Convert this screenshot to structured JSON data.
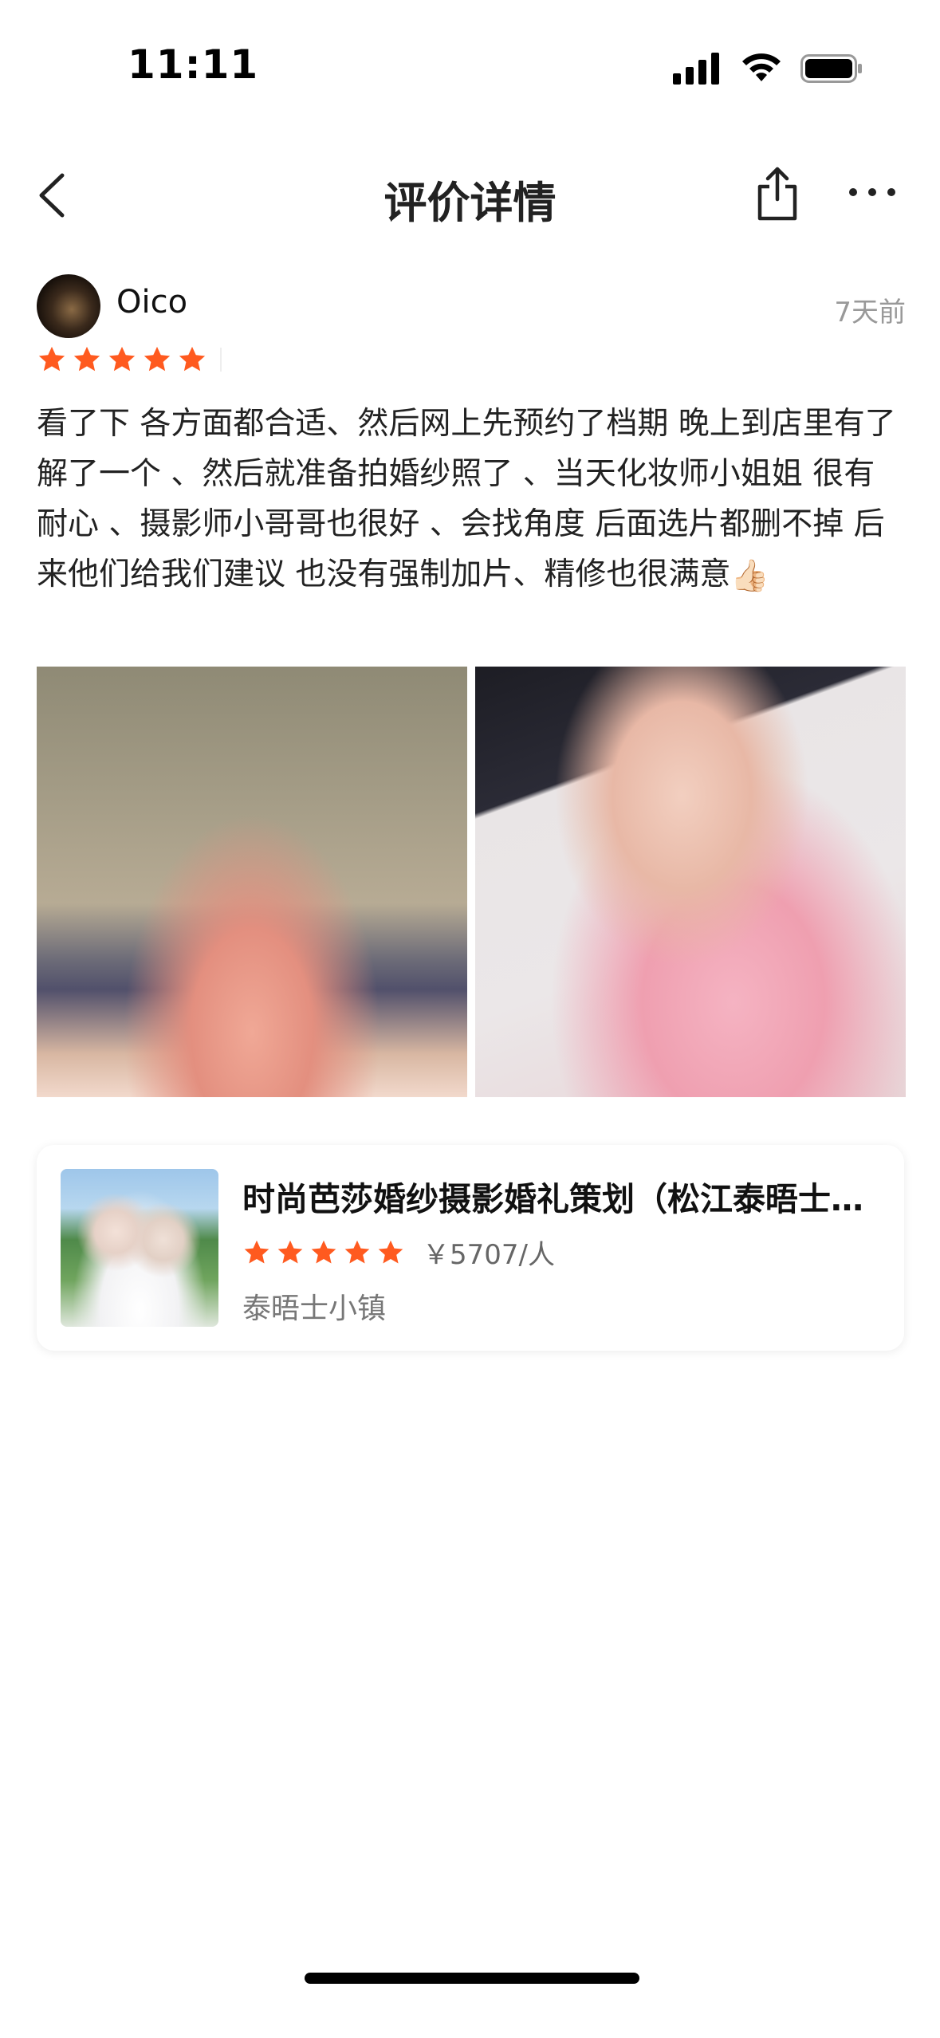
{
  "status_bar": {
    "time": "11:11"
  },
  "nav": {
    "title": "评价详情"
  },
  "review": {
    "username": "Oico",
    "time_ago": "7天前",
    "rating": 5,
    "text": "看了下 各方面都合适、然后网上先预约了档期 晚上到店里有了解了一个 、然后就准备拍婚纱照了 、当天化妆师小姐姐 很有耐心 、摄影师小哥哥也很好 、会找角度 后面选片都删不掉 后来他们给我们建议 也没有强制加片、精修也很满意",
    "emoji": "👍🏻"
  },
  "product": {
    "title": "时尚芭莎婚纱摄影婚礼策划（松江泰晤士小镇店）",
    "rating": 5,
    "price": "￥5707/人",
    "location": "泰晤士小镇"
  },
  "colors": {
    "star": "#FF5A1F",
    "accent": "#FF5A1F"
  },
  "icons": [
    "back-icon",
    "share-icon",
    "more-icon",
    "signal-icon",
    "wifi-icon",
    "battery-icon",
    "star-icon"
  ]
}
